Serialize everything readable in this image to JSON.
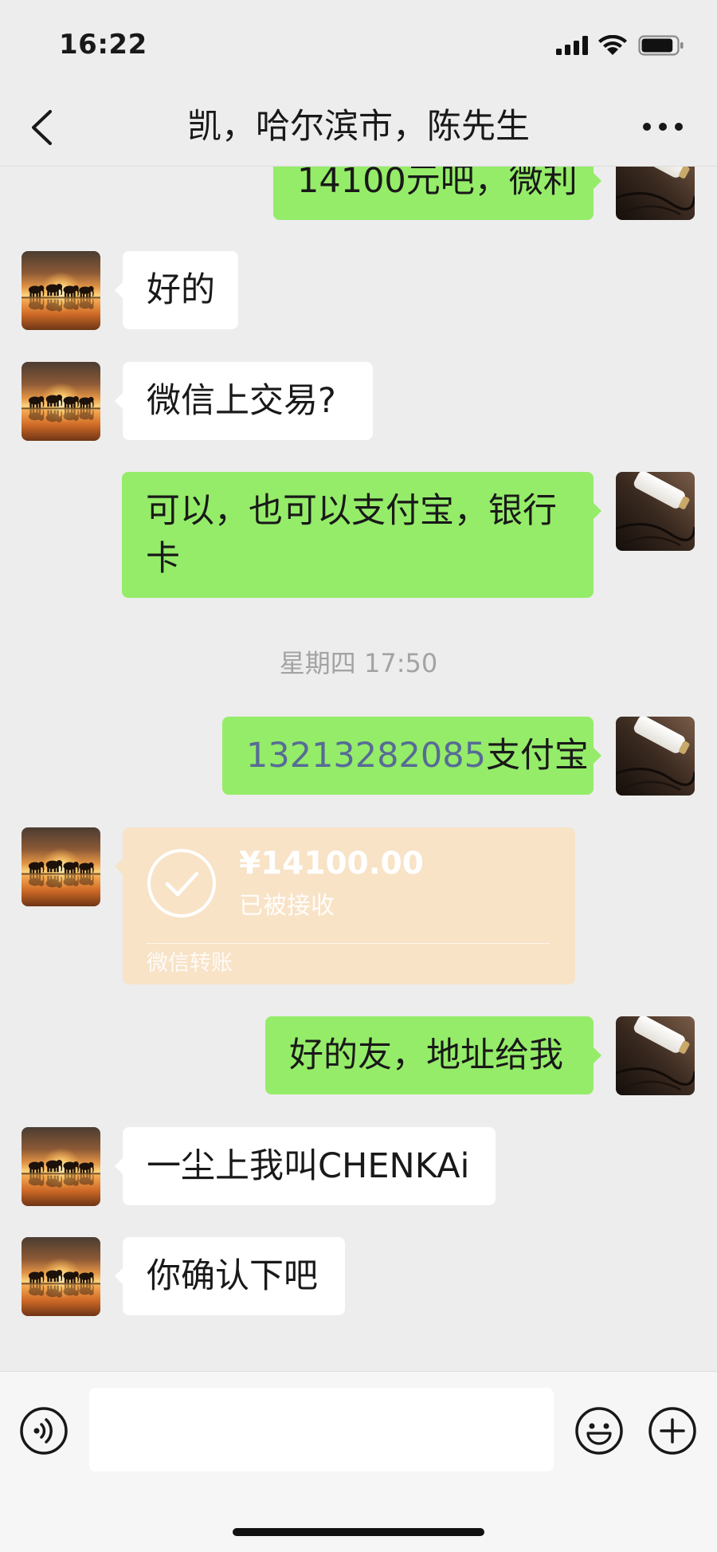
{
  "status_bar": {
    "time": "16:22",
    "battery_level": 0.9
  },
  "nav": {
    "title": "凯，哈尔滨市，陈先生"
  },
  "chat": {
    "messages": [
      {
        "outgoing": true,
        "text": "14100元吧，微利"
      },
      {
        "outgoing": false,
        "text": "好的"
      },
      {
        "outgoing": false,
        "text": "微信上交易?"
      },
      {
        "outgoing": true,
        "text": "可以，也可以支付宝，银行卡"
      },
      {
        "time_divider": "星期四 17:50"
      },
      {
        "outgoing": true,
        "phone": "13213282085",
        "text": "支付宝"
      },
      {
        "outgoing": false,
        "transfer": {
          "amount": "¥14100.00",
          "status": "已被接收",
          "label": "微信转账"
        }
      },
      {
        "outgoing": true,
        "text": "好的友，地址给我"
      },
      {
        "outgoing": false,
        "text": "一尘上我叫CHENKAi"
      },
      {
        "outgoing": false,
        "text": "你确认下吧"
      }
    ]
  },
  "input_bar": {
    "value": ""
  },
  "icons": {
    "signal": "signal-icon",
    "wifi": "wifi-icon",
    "battery": "battery-icon",
    "back": "chevron-left-icon",
    "more": "more-dots-icon",
    "transfer_check": "check-circle-icon",
    "voice": "voice-icon",
    "emoji": "emoji-icon",
    "plus": "plus-icon"
  },
  "avatars": {
    "contact": "elephants-sunset-avatar",
    "self": "jade-pendant-avatar"
  },
  "colors": {
    "chat_bg": "#ededed",
    "bubble_outgoing": "#95ec69",
    "bubble_incoming": "#ffffff",
    "transfer_card": "#f8e3c7",
    "phone_link": "#576b95"
  }
}
